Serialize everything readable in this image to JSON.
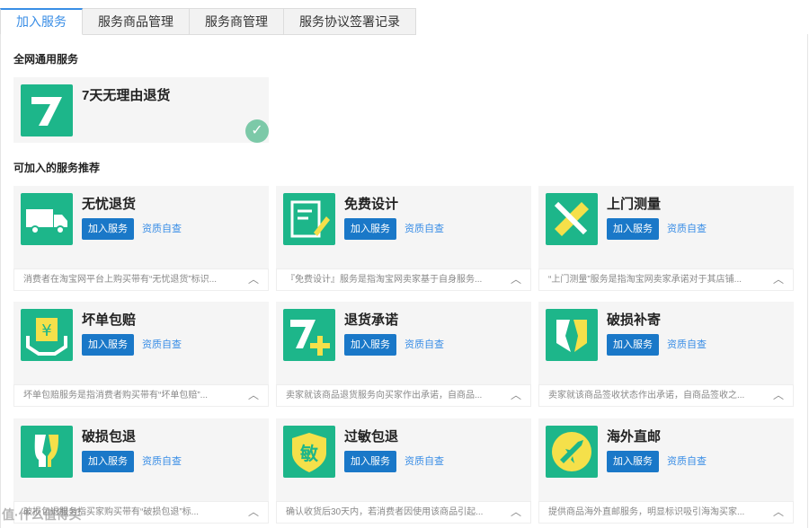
{
  "tabs": [
    {
      "label": "加入服务",
      "active": true
    },
    {
      "label": "服务商品管理",
      "active": false
    },
    {
      "label": "服务商管理",
      "active": false
    },
    {
      "label": "服务协议签署记录",
      "active": false
    }
  ],
  "sections": {
    "general_title": "全网通用服务",
    "recommended_title": "可加入的服务推荐"
  },
  "general_service": {
    "title": "7天无理由退货",
    "icon": "seven-icon"
  },
  "buttons": {
    "join": "加入服务",
    "check": "资质自查"
  },
  "services": [
    {
      "title": "无忧退货",
      "icon": "truck-icon",
      "desc": "消费者在淘宝网平台上购买带有“无忧退货”标识..."
    },
    {
      "title": "免费设计",
      "icon": "design-icon",
      "desc": "『免费设计』服务是指淘宝网卖家基于自身服务..."
    },
    {
      "title": "上门测量",
      "icon": "measure-icon",
      "desc": "“上门测量”服务是指淘宝网卖家承诺对于其店铺..."
    },
    {
      "title": "坏单包赔",
      "icon": "yen-hands-icon",
      "desc": "坏单包赔服务是指消费者购买带有“坏单包赔”..."
    },
    {
      "title": "退货承诺",
      "icon": "seven-plus-icon",
      "desc": "卖家就该商品退货服务向买家作出承诺，自商品..."
    },
    {
      "title": "破损补寄",
      "icon": "shield-split-icon",
      "desc": "卖家就该商品签收状态作出承诺，自商品签收之..."
    },
    {
      "title": "破损包退",
      "icon": "broken-glass-icon",
      "desc": "破损包退服务指买家购买带有“破损包退”标..."
    },
    {
      "title": "过敏包退",
      "icon": "allergy-shield-icon",
      "desc": "确认收货后30天内，若消费者因使用该商品引起..."
    },
    {
      "title": "海外直邮",
      "icon": "plane-icon",
      "desc": "提供商品海外直邮服务，明显标识吸引海淘买家..."
    }
  ],
  "watermark": "值·什么值得买",
  "colors": {
    "accent": "#1a78c8",
    "icon_green": "#1db68a",
    "link": "#3a8ee6"
  }
}
